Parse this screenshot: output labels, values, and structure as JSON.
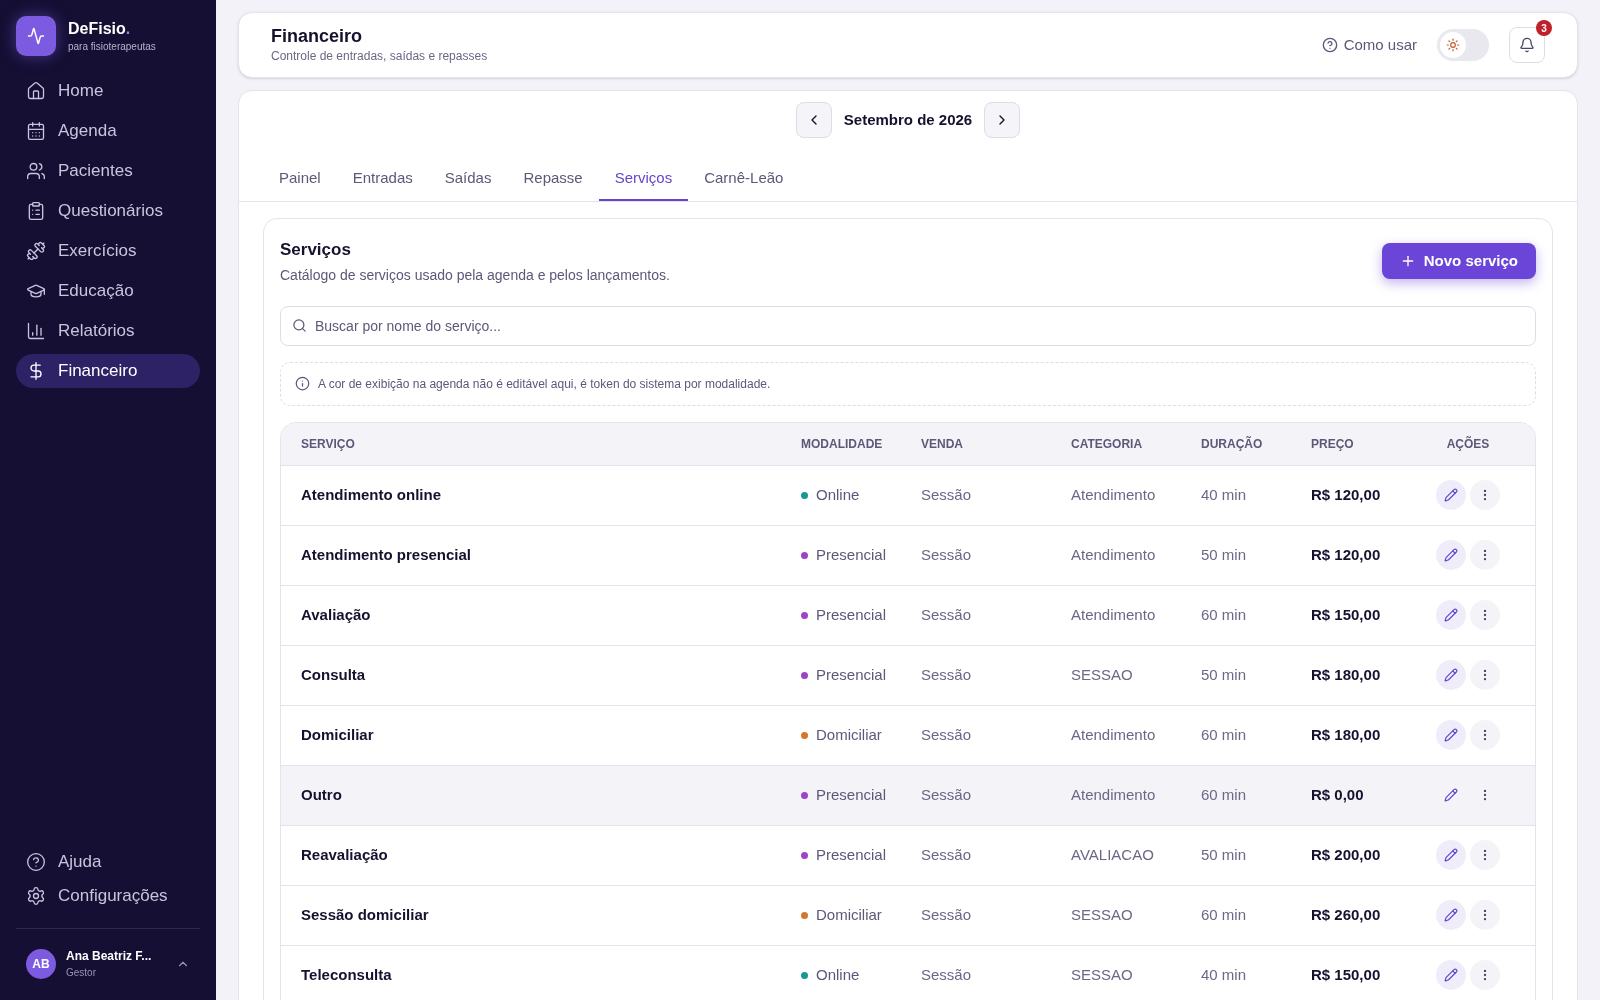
{
  "brand": {
    "name": "DeFisio",
    "dot": ".",
    "tagline": "para fisioterapeutas"
  },
  "nav": [
    {
      "label": "Home",
      "selected": false
    },
    {
      "label": "Agenda",
      "selected": false
    },
    {
      "label": "Pacientes",
      "selected": false
    },
    {
      "label": "Questionários",
      "selected": false
    },
    {
      "label": "Exercícios",
      "selected": false
    },
    {
      "label": "Educação",
      "selected": false
    },
    {
      "label": "Relatórios",
      "selected": false
    },
    {
      "label": "Financeiro",
      "selected": true
    }
  ],
  "nav_bottom": [
    {
      "label": "Ajuda"
    },
    {
      "label": "Configurações"
    }
  ],
  "user": {
    "initials": "AB",
    "name": "Ana Beatriz F...",
    "role": "Gestor"
  },
  "header": {
    "title": "Financeiro",
    "subtitle": "Controle de entradas, saídas e repasses",
    "help": "Como usar",
    "theme_dark": false,
    "notifications": "3"
  },
  "month": "Setembro de 2026",
  "tabs": [
    {
      "label": "Painel",
      "selected": false
    },
    {
      "label": "Entradas",
      "selected": false
    },
    {
      "label": "Saídas",
      "selected": false
    },
    {
      "label": "Repasse",
      "selected": false
    },
    {
      "label": "Serviços",
      "selected": true
    },
    {
      "label": "Carnê-Leão",
      "selected": false
    }
  ],
  "section": {
    "title": "Serviços",
    "subtitle": "Catálogo de serviços usado pela agenda e pelos lançamentos.",
    "new_button": "Novo serviço"
  },
  "search": {
    "placeholder": "Buscar por nome do serviço..."
  },
  "notice": "A cor de exibição na agenda não é editável aqui, é token do sistema por modalidade.",
  "table": {
    "columns": [
      "SERVIÇO",
      "MODALIDADE",
      "VENDA",
      "CATEGORIA",
      "DURAÇÃO",
      "PREÇO",
      "AÇÕES"
    ],
    "rows": [
      {
        "name": "Atendimento online",
        "modality": "Online",
        "color": "#14999b",
        "sale": "Sessão",
        "category": "Atendimento",
        "duration": "40 min",
        "price": "R$ 120,00",
        "selected": false
      },
      {
        "name": "Atendimento presencial",
        "modality": "Presencial",
        "color": "#9b44c9",
        "sale": "Sessão",
        "category": "Atendimento",
        "duration": "50 min",
        "price": "R$ 120,00",
        "selected": false
      },
      {
        "name": "Avaliação",
        "modality": "Presencial",
        "color": "#9b44c9",
        "sale": "Sessão",
        "category": "Atendimento",
        "duration": "60 min",
        "price": "R$ 150,00",
        "selected": false
      },
      {
        "name": "Consulta",
        "modality": "Presencial",
        "color": "#9b44c9",
        "sale": "Sessão",
        "category": "SESSAO",
        "duration": "50 min",
        "price": "R$ 180,00",
        "selected": false
      },
      {
        "name": "Domiciliar",
        "modality": "Domiciliar",
        "color": "#d4762c",
        "sale": "Sessão",
        "category": "Atendimento",
        "duration": "60 min",
        "price": "R$ 180,00",
        "selected": false
      },
      {
        "name": "Outro",
        "modality": "Presencial",
        "color": "#9b44c9",
        "sale": "Sessão",
        "category": "Atendimento",
        "duration": "60 min",
        "price": "R$ 0,00",
        "selected": true
      },
      {
        "name": "Reavaliação",
        "modality": "Presencial",
        "color": "#9b44c9",
        "sale": "Sessão",
        "category": "AVALIACAO",
        "duration": "50 min",
        "price": "R$ 200,00",
        "selected": false
      },
      {
        "name": "Sessão domiciliar",
        "modality": "Domiciliar",
        "color": "#d4762c",
        "sale": "Sessão",
        "category": "SESSAO",
        "duration": "60 min",
        "price": "R$ 260,00",
        "selected": false
      },
      {
        "name": "Teleconsulta",
        "modality": "Online",
        "color": "#14999b",
        "sale": "Sessão",
        "category": "SESSAO",
        "duration": "40 min",
        "price": "R$ 150,00",
        "selected": false
      }
    ]
  }
}
